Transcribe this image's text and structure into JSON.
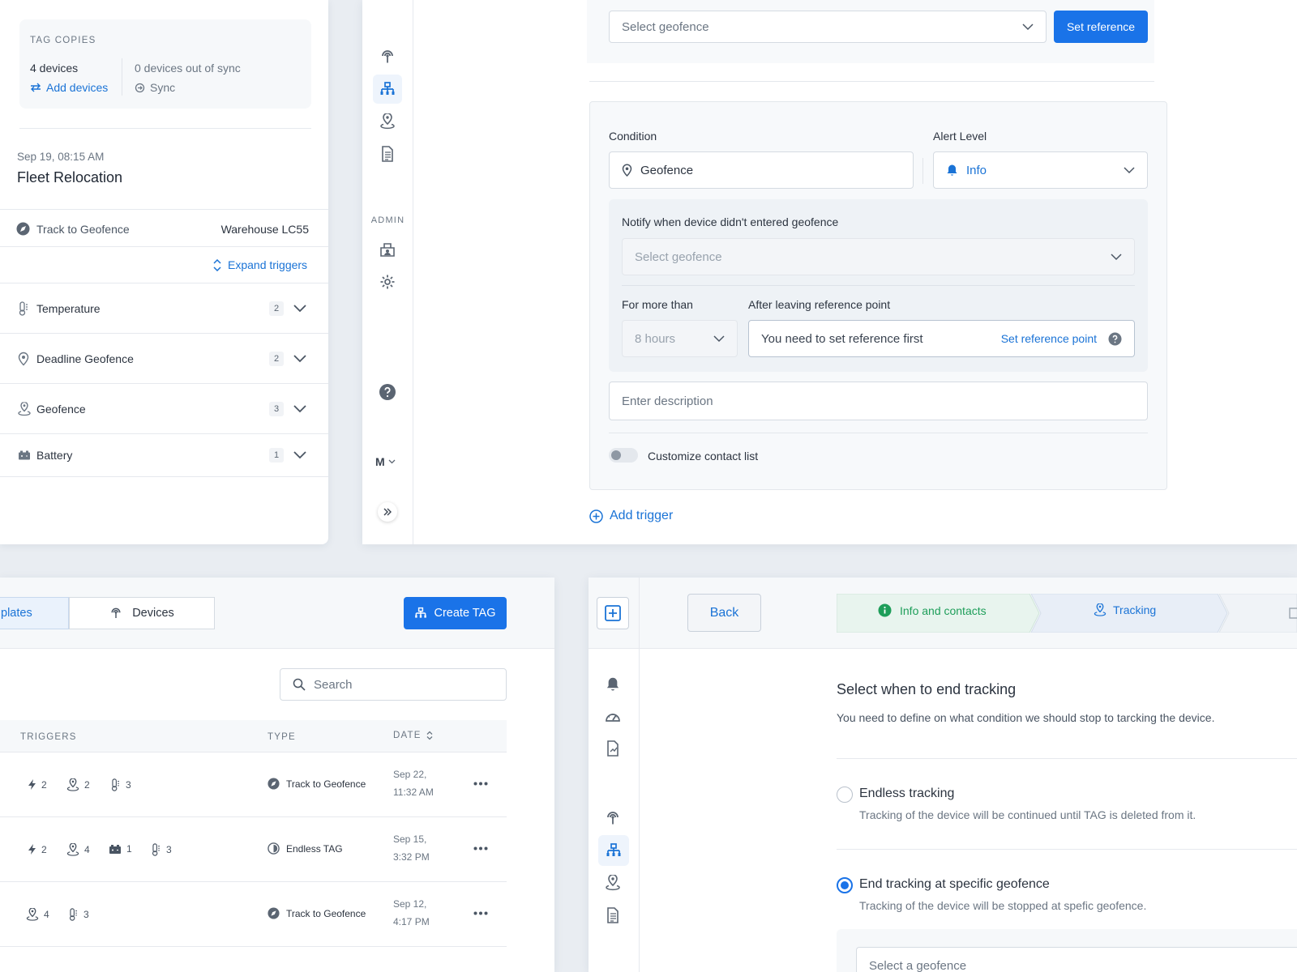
{
  "tag_panel": {
    "tag_copies_label": "TAG COPIES",
    "devices_count": "4 devices",
    "add_devices": "Add devices",
    "out_of_sync": "0 devices out of sync",
    "sync": "Sync",
    "timestamp": "Sep 19, 08:15 AM",
    "title": "Fleet Relocation",
    "track_label": "Track to Geofence",
    "track_target": "Warehouse LC55",
    "expand_triggers": "Expand triggers",
    "triggers": [
      {
        "label": "Temperature",
        "count": "2",
        "icon": "thermometer-icon"
      },
      {
        "label": "Deadline Geofence",
        "count": "2",
        "icon": "location-pin-icon"
      },
      {
        "label": "Geofence",
        "count": "3",
        "icon": "geofence-icon"
      },
      {
        "label": "Battery",
        "count": "1",
        "icon": "battery-icon"
      }
    ]
  },
  "nav_rail": {
    "admin_label": "ADMIN",
    "user_initial": "M"
  },
  "condition_form": {
    "top_select_placeholder": "Select geofence",
    "set_reference_button": "Set reference",
    "condition_label": "Condition",
    "condition_value": "Geofence",
    "alert_level_label": "Alert Level",
    "alert_level_value": "Info",
    "notify_label": "Notify when device didn't entered geofence",
    "notify_select_placeholder": "Select geofence",
    "for_more_than_label": "For more than",
    "for_more_than_value": "8 hours",
    "after_leaving_label": "After leaving reference point",
    "reference_hint": "You need to set reference first",
    "set_reference_point": "Set reference point",
    "description_placeholder": "Enter description",
    "customize_contact": "Customize contact list",
    "add_trigger": "Add trigger"
  },
  "tag_list": {
    "tab_templates": "plates",
    "tab_devices": "Devices",
    "create_tag": "Create TAG",
    "search_placeholder": "Search",
    "headers": {
      "triggers": "TRIGGERS",
      "type": "TYPE",
      "date": "DATE"
    },
    "rows": [
      {
        "triggers": [
          {
            "icon": "lightning-icon",
            "n": "2"
          },
          {
            "icon": "geofence-icon",
            "n": "2"
          },
          {
            "icon": "thermometer-icon",
            "n": "3"
          }
        ],
        "type": "Track to Geofence",
        "type_icon": "track-icon",
        "date1": "Sep 22,",
        "date2": "11:32 AM"
      },
      {
        "triggers": [
          {
            "icon": "lightning-icon",
            "n": "2"
          },
          {
            "icon": "geofence-icon",
            "n": "4"
          },
          {
            "icon": "battery-icon",
            "n": "1"
          },
          {
            "icon": "thermometer-icon",
            "n": "3"
          }
        ],
        "type": "Endless TAG",
        "type_icon": "endless-icon",
        "date1": "Sep 15,",
        "date2": "3:32 PM"
      },
      {
        "triggers": [
          {
            "icon": "geofence-icon",
            "n": "4"
          },
          {
            "icon": "thermometer-icon",
            "n": "3"
          }
        ],
        "type": "Track to Geofence",
        "type_icon": "track-icon",
        "date1": "Sep 12,",
        "date2": "4:17 PM"
      }
    ]
  },
  "wizard": {
    "back": "Back",
    "steps": [
      {
        "label": "Info and contacts",
        "state": "done"
      },
      {
        "label": "Tracking",
        "state": "active"
      }
    ],
    "section_title": "Select when to end tracking",
    "section_desc": "You need to define on what condition we should stop to tarcking the device.",
    "options": [
      {
        "title": "Endless tracking",
        "desc": "Tracking of the device will be continued until TAG is deleted from it.",
        "selected": false
      },
      {
        "title": "End tracking at specific geofence",
        "desc": "Tracking of the device will be stopped at spefic geofence.",
        "selected": true
      }
    ],
    "geofence_select_placeholder": "Select a geofence"
  }
}
